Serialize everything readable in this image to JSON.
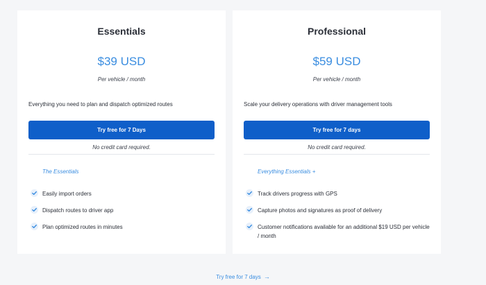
{
  "plans": [
    {
      "title": "Essentials",
      "price": "$39 USD",
      "per": "Per vehicle / month",
      "description": "Everything you need to plan and dispatch optimized routes",
      "cta": "Try free for 7 Days",
      "no_card": "No credit card required.",
      "section_label": "The Essentials",
      "features": [
        "Easily import orders",
        "Dispatch routes to driver app",
        "Plan optimized routes in minutes"
      ]
    },
    {
      "title": "Professional",
      "price": "$59 USD",
      "per": "Per vehicle / month",
      "description": "Scale your delivery operations with driver management tools",
      "cta": "Try free for 7 days",
      "no_card": "No credit card required.",
      "section_label": "Everything Essentials +",
      "features": [
        "Track drivers progress with GPS",
        "Capture photos and signatures as proof of delivery",
        "Customer notifications available for an additional $19 USD per vehicle / month"
      ]
    }
  ],
  "footer": {
    "link_label": "Try free for 7 days",
    "arrow_icon": "→"
  },
  "colors": {
    "accent": "#3a8de0",
    "button": "#0f5fc9",
    "background": "#f5f6f8",
    "card": "#ffffff"
  }
}
